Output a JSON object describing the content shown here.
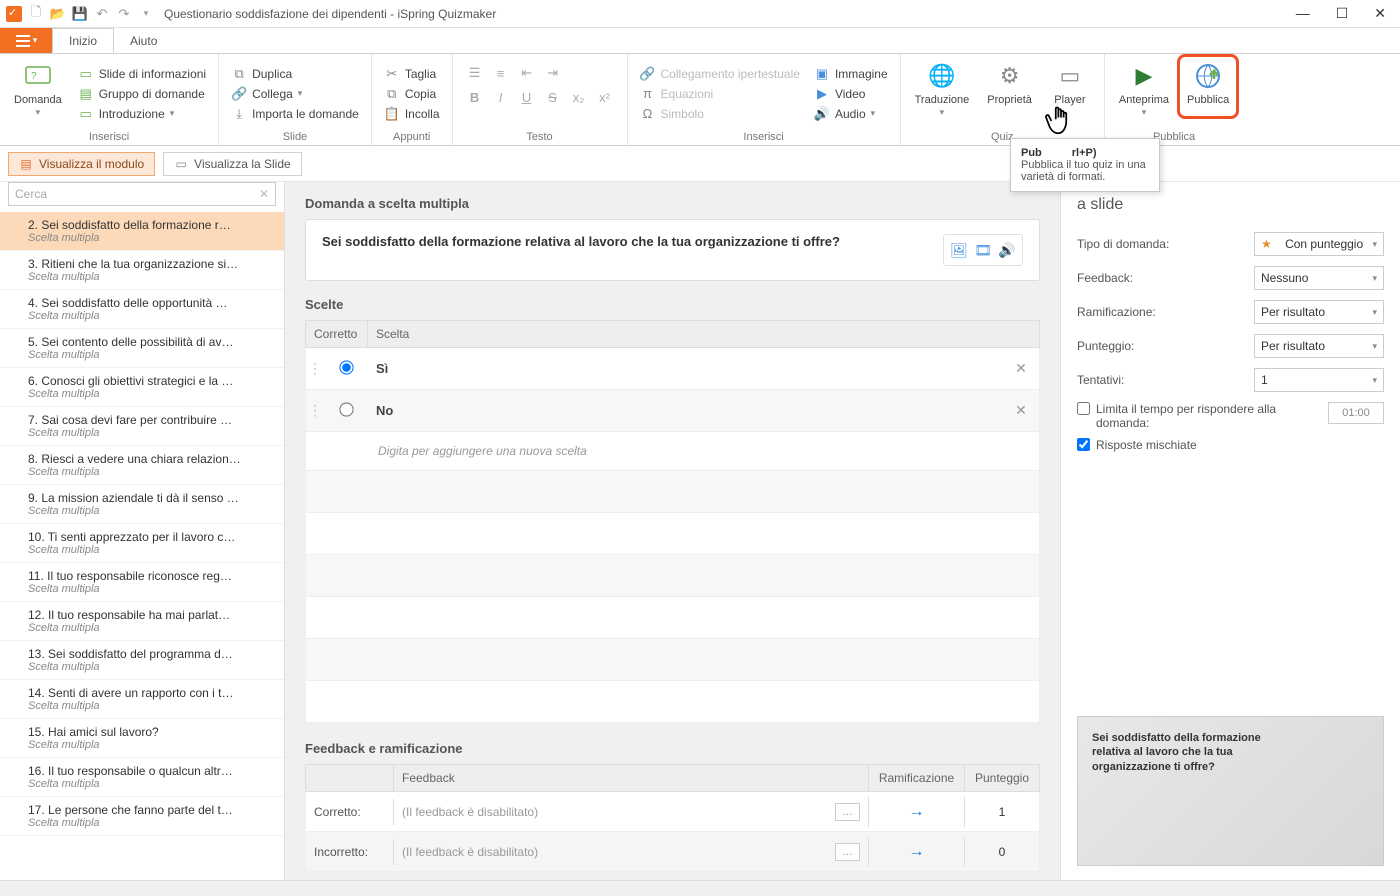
{
  "title": "Questionario soddisfazione dei dipendenti - iSpring Quizmaker",
  "tabs": {
    "inizio": "Inizio",
    "aiuto": "Aiuto"
  },
  "ribbon": {
    "domanda": "Domanda",
    "slide_info": "Slide di informazioni",
    "gruppo_domande": "Gruppo di domande",
    "introduzione": "Introduzione",
    "duplica": "Duplica",
    "collega": "Collega",
    "importa": "Importa le domande",
    "taglia": "Taglia",
    "copia": "Copia",
    "incolla": "Incolla",
    "collegamento": "Collegamento ipertestuale",
    "equazioni": "Equazioni",
    "simbolo": "Simbolo",
    "immagine": "Immagine",
    "video": "Video",
    "audio": "Audio",
    "traduzione": "Traduzione",
    "proprieta": "Proprietà",
    "player": "Player",
    "anteprima": "Anteprima",
    "pubblica": "Pubblica",
    "group_inserisci": "Inserisci",
    "group_slide": "Slide",
    "group_appunti": "Appunti",
    "group_testo": "Testo",
    "group_inserisci2": "Inserisci",
    "group_quiz": "Quiz",
    "group_pubblica": "Pubblica"
  },
  "view": {
    "modulo": "Visualizza il modulo",
    "slide": "Visualizza la Slide"
  },
  "search_placeholder": "Cerca",
  "questions": [
    {
      "n": "2.",
      "t": "Sei soddisfatto della formazione r…",
      "sub": "Scelta multipla",
      "sel": true
    },
    {
      "n": "3.",
      "t": "Ritieni che la tua organizzazione si…",
      "sub": "Scelta multipla"
    },
    {
      "n": "4.",
      "t": "Sei soddisfatto delle opportunità …",
      "sub": "Scelta multipla"
    },
    {
      "n": "5.",
      "t": "Sei contento delle possibilità di av…",
      "sub": "Scelta multipla"
    },
    {
      "n": "6.",
      "t": "Conosci gli obiettivi strategici e la …",
      "sub": "Scelta multipla"
    },
    {
      "n": "7.",
      "t": "Sai cosa devi fare per contribuire …",
      "sub": "Scelta multipla"
    },
    {
      "n": "8.",
      "t": "Riesci a vedere una chiara relazion…",
      "sub": "Scelta multipla"
    },
    {
      "n": "9.",
      "t": "La mission aziendale ti dà il senso …",
      "sub": "Scelta multipla"
    },
    {
      "n": "10.",
      "t": "Ti senti apprezzato per il lavoro c…",
      "sub": "Scelta multipla"
    },
    {
      "n": "11.",
      "t": "Il tuo responsabile riconosce reg…",
      "sub": "Scelta multipla"
    },
    {
      "n": "12.",
      "t": "Il tuo responsabile ha mai parlat…",
      "sub": "Scelta multipla"
    },
    {
      "n": "13.",
      "t": "Sei soddisfatto del programma d…",
      "sub": "Scelta multipla"
    },
    {
      "n": "14.",
      "t": "Senti di avere un rapporto con i t…",
      "sub": "Scelta multipla"
    },
    {
      "n": "15.",
      "t": "Hai amici sul lavoro?",
      "sub": "Scelta multipla"
    },
    {
      "n": "16.",
      "t": "Il tuo responsabile o qualcun altr…",
      "sub": "Scelta multipla"
    },
    {
      "n": "17.",
      "t": "Le persone che fanno parte del t…",
      "sub": "Scelta multipla"
    }
  ],
  "editor": {
    "heading": "Domanda a scelta multipla",
    "question": "Sei soddisfatto della formazione relativa al lavoro che la tua organizzazione ti offre?",
    "scelte_label": "Scelte",
    "col_corretto": "Corretto",
    "col_scelta": "Scelta",
    "choices": [
      {
        "text": "Sì",
        "correct": true
      },
      {
        "text": "No",
        "correct": false
      }
    ],
    "add_placeholder": "Digita per aggiungere una nuova scelta",
    "feedback_heading": "Feedback e ramificazione",
    "fb_col_feedback": "Feedback",
    "fb_col_ram": "Ramificazione",
    "fb_col_punt": "Punteggio",
    "fb_rows": [
      {
        "label": "Corretto:",
        "text": "(Il feedback è disabilitato)",
        "score": "1"
      },
      {
        "label": "Incorretto:",
        "text": "(Il feedback è disabilitato)",
        "score": "0"
      }
    ]
  },
  "props": {
    "title_suffix": "a slide",
    "tipo_domanda": "Tipo di domanda:",
    "tipo_domanda_val": "Con punteggio",
    "feedback": "Feedback:",
    "feedback_val": "Nessuno",
    "ramificazione": "Ramificazione:",
    "ramificazione_val": "Per risultato",
    "punteggio": "Punteggio:",
    "punteggio_val": "Per risultato",
    "tentativi": "Tentativi:",
    "tentativi_val": "1",
    "limita": "Limita il tempo per rispondere alla domanda:",
    "limita_time": "01:00",
    "risposte_mischiate": "Risposte mischiate",
    "preview_text": "Sei soddisfatto della formazione relativa al lavoro che la tua organizzazione ti offre?"
  },
  "tooltip": {
    "title": "Pubblica (Ctrl+P)",
    "body": "Pubblica il tuo quiz in una varietà di formati."
  }
}
